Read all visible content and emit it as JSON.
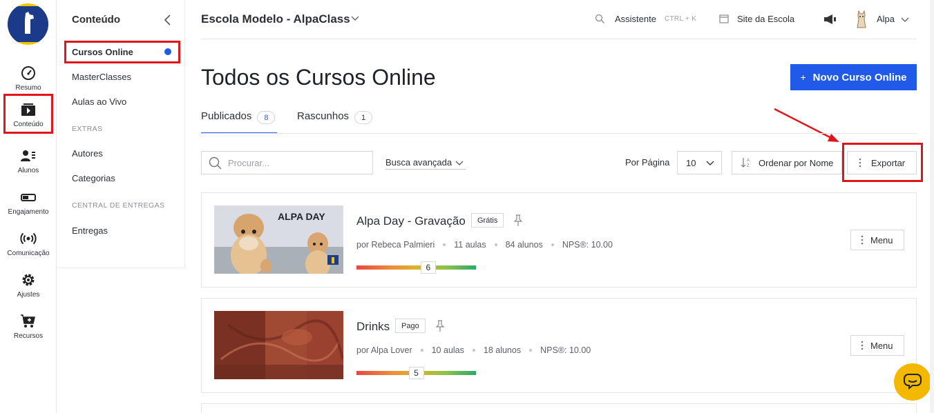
{
  "rail": {
    "items": [
      {
        "label": "Resumo",
        "icon": "dashboard-icon"
      },
      {
        "label": "Conteúdo",
        "icon": "play-stack-icon"
      },
      {
        "label": "Alunos",
        "icon": "students-icon"
      },
      {
        "label": "Engajamento",
        "icon": "toggle-icon"
      },
      {
        "label": "Comunicação",
        "icon": "broadcast-icon"
      },
      {
        "label": "Ajustes",
        "icon": "gear-icon"
      },
      {
        "label": "Recursos",
        "icon": "cart-plus-icon"
      }
    ]
  },
  "sidebar": {
    "title": "Conteúdo",
    "items": [
      {
        "label": "Cursos Online"
      },
      {
        "label": "MasterClasses"
      },
      {
        "label": "Aulas ao Vivo"
      },
      {
        "label": "Autores"
      },
      {
        "label": "Categorias"
      },
      {
        "label": "Entregas"
      }
    ],
    "sections": [
      "EXTRAS",
      "CENTRAL DE ENTREGAS"
    ]
  },
  "topbar": {
    "school": "Escola Modelo - AlpaClass",
    "assistant": "Assistente",
    "shortcut": "CTRL + K",
    "site": "Site da Escola",
    "user": "Alpa"
  },
  "page": {
    "title": "Todos os Cursos Online",
    "new_button": "Novo Curso Online"
  },
  "tabs": [
    {
      "label": "Publicados",
      "count": "8"
    },
    {
      "label": "Rascunhos",
      "count": "1"
    }
  ],
  "toolbar": {
    "search_placeholder": "Procurar...",
    "advanced": "Busca avançada",
    "per_page_label": "Por Página",
    "per_page_value": "10",
    "sort": "Ordenar por Nome",
    "export": "Exportar"
  },
  "courses": [
    {
      "title": "Alpa Day - Gravação",
      "tag": "Grátis",
      "author": "por Rebeca Palmieri",
      "lessons": "11 aulas",
      "students": "84 alunos",
      "nps": "NPS®: 10.00",
      "score": "6",
      "score_fraction": 0.6,
      "thumb_text": "ALPA DAY",
      "menu": "Menu"
    },
    {
      "title": "Drinks",
      "tag": "Pago",
      "author": "por Alpa Lover",
      "lessons": "10 aulas",
      "students": "18 alunos",
      "nps": "NPS®: 10.00",
      "score": "5",
      "score_fraction": 0.5,
      "menu": "Menu"
    }
  ],
  "colors": {
    "accent": "#1f5ae8",
    "highlight": "#e0141b",
    "chat": "#f5b800"
  }
}
